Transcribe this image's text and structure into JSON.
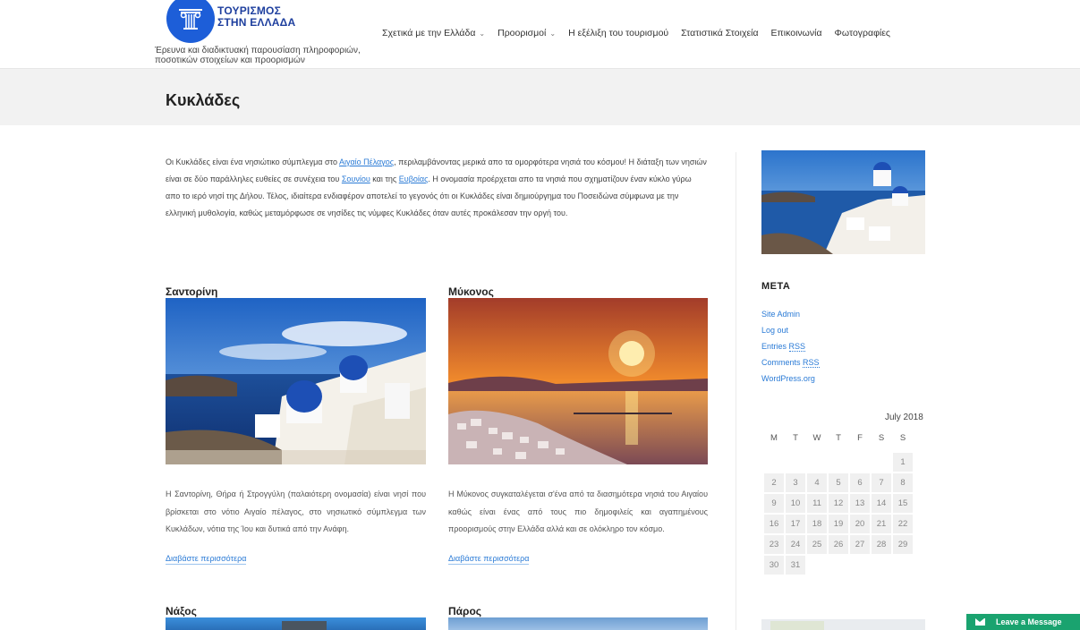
{
  "site": {
    "logo_text_line1": "ΤΟΥΡΙΣΜΟΣ",
    "logo_text_line2": "ΣΤΗΝ ΕΛΛΑΔΑ",
    "tagline_line1": "Έρευνα και διαδικτυακή παρουσίαση πληροφοριών,",
    "tagline_line2": "ποσοτικών στοιχείων και προορισμών"
  },
  "nav": [
    {
      "label": "Σχετικά με την Ελλάδα",
      "has_dropdown": true
    },
    {
      "label": "Προορισμοί",
      "has_dropdown": true
    },
    {
      "label": "Η εξέλιξη του τουρισμού",
      "has_dropdown": false
    },
    {
      "label": "Στατιστικά Στοιχεία",
      "has_dropdown": false
    },
    {
      "label": "Επικοινωνία",
      "has_dropdown": false
    },
    {
      "label": "Φωτογραφίες",
      "has_dropdown": false
    }
  ],
  "page": {
    "title": "Κυκλάδες",
    "intro": {
      "p1": "Οι Κυκλάδες είναι ένα νησιώτικο σύμπλεγμα στο ",
      "link1": "Αιγαίο Πέλαγος",
      "p2": ", περιλαμβάνοντας μερικά απο τα ομορφότερα νησιά του κόσμου! Η διάταξη των νησιών είναι σε δύο παράλληλες ευθείες σε συνέχεια του ",
      "link2": "Σουνίου",
      "p3": " και της ",
      "link3": "Ευβοίας",
      "p4": ". Η ονομασία προέρχεται απο τα νησιά που σχηματίζουν έναν κύκλο γύρω απο το ιερό νησί της Δήλου. Τέλος, ιδιαίτερα ενδιαφέρον αποτελεί το γεγονός ότι οι Κυκλάδες είναι δημιούργημα του Ποσειδώνα σύμφωνα με την ελληνική μυθολογία, καθώς μεταμόρφωσε σε νησίδες τις νύμφες Κυκλάδες όταν αυτές προκάλεσαν την οργή του."
    }
  },
  "cards": [
    {
      "title": "Σαντορίνη",
      "text": "Η Σαντορίνη, Θήρα ή Στρογγύλη (παλαιότερη ονομασία) είναι νησί που βρίσκεται στο νότιο Αιγαίο πέλαγος, στο νησιωτικό σύμπλεγμα των Κυκλάδων, νότια της Ίου και δυτικά από την Ανάφη.",
      "read_more": "Διαβάστε περισσότερα"
    },
    {
      "title": "Μύκονος",
      "text": "Η Μύκονος συγκαταλέγεται σ'ένα από τα διασημότερα νησιά του Αιγαίου καθώς είναι ένας από τους πιο δημοφιλείς και αγαπημένους προορισμούς στην Ελλάδα αλλά και σε ολόκληρο τον κόσμο.",
      "read_more": "Διαβάστε περισσότερα"
    },
    {
      "title": "Νάξος"
    },
    {
      "title": "Πάρος"
    }
  ],
  "sidebar": {
    "meta_title": "META",
    "meta_links": {
      "site_admin": "Site Admin",
      "log_out": "Log out",
      "entries": "Entries",
      "comments": "Comments",
      "rss": "RSS",
      "wordpress": "WordPress.org"
    },
    "calendar": {
      "caption": "July 2018",
      "weekdays": [
        "M",
        "T",
        "W",
        "T",
        "F",
        "S",
        "S"
      ],
      "leading_blanks": 6,
      "days": 31
    }
  },
  "chat": {
    "label": "Leave a Message"
  },
  "colors": {
    "accent_blue": "#2b7bd6",
    "logo_blue": "#1d5ed8",
    "chat_green": "#1aa36f"
  }
}
